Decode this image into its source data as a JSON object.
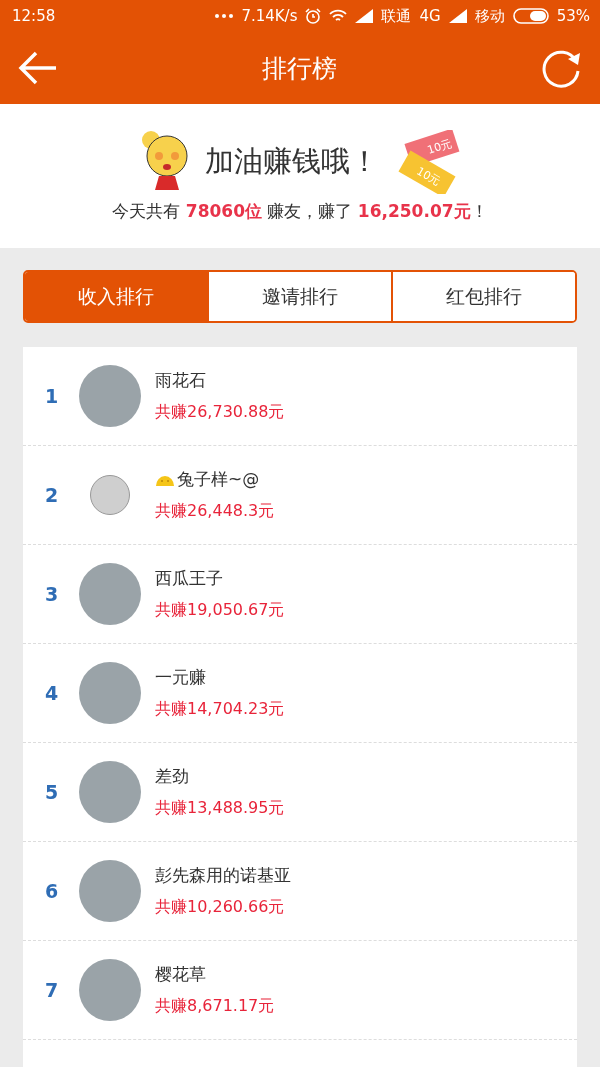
{
  "status_bar": {
    "time": "12:58",
    "speed": "7.14K/s",
    "carrier_1": "联通",
    "network": "4G",
    "carrier_2": "移动",
    "battery": "53%"
  },
  "header": {
    "title": "排行榜"
  },
  "banner": {
    "title": "加油赚钱哦！",
    "bills": [
      "10元",
      "10元"
    ],
    "subtitle": "今天共有 **78060位** 赚友，赚了 **16,250.07元**！"
  },
  "tabs": [
    {
      "label": "收入排行",
      "selected": true
    },
    {
      "label": "邀请排行",
      "selected": false
    },
    {
      "label": "红包排行",
      "selected": false
    }
  ],
  "ranking": [
    {
      "rank": "1",
      "name": "雨花石",
      "earned": "共赚26,730.88元",
      "emoji": false,
      "avatar_small": false
    },
    {
      "rank": "2",
      "name": "兔子样~@",
      "earned": "共赚26,448.3元",
      "emoji": true,
      "avatar_small": true
    },
    {
      "rank": "3",
      "name": "西瓜王子",
      "earned": "共赚19,050.67元",
      "emoji": false,
      "avatar_small": false
    },
    {
      "rank": "4",
      "name": "一元赚",
      "earned": "共赚14,704.23元",
      "emoji": false,
      "avatar_small": false
    },
    {
      "rank": "5",
      "name": "差劲",
      "earned": "共赚13,488.95元",
      "emoji": false,
      "avatar_small": false
    },
    {
      "rank": "6",
      "name": "彭先森用的诺基亚",
      "earned": "共赚10,260.66元",
      "emoji": false,
      "avatar_small": false
    },
    {
      "rank": "7",
      "name": "樱花草",
      "earned": "共赚8,671.17元",
      "emoji": false,
      "avatar_small": false
    }
  ]
}
